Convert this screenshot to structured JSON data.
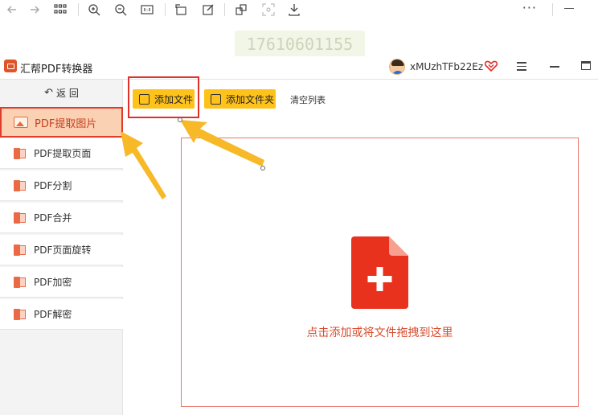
{
  "watermark": "17610601155",
  "app": {
    "title": "汇帮PDF转换器",
    "username": "xMUzhTFb22Ez"
  },
  "sidebar": {
    "back_label": "返 回",
    "items": [
      {
        "label": "PDF提取图片",
        "active": true
      },
      {
        "label": "PDF提取页面"
      },
      {
        "label": "PDF分割"
      },
      {
        "label": "PDF合并"
      },
      {
        "label": "PDF页面旋转"
      },
      {
        "label": "PDF加密"
      },
      {
        "label": "PDF解密"
      }
    ]
  },
  "toolbar": {
    "add_file": "添加文件",
    "add_folder": "添加文件夹",
    "clear_list": "清空列表"
  },
  "dropzone": {
    "hint": "点击添加或将文件拖拽到这里"
  },
  "colors": {
    "accent_yellow": "#ffc21a",
    "accent_red": "#e0302a",
    "pdf_icon_red": "#e8321e"
  }
}
